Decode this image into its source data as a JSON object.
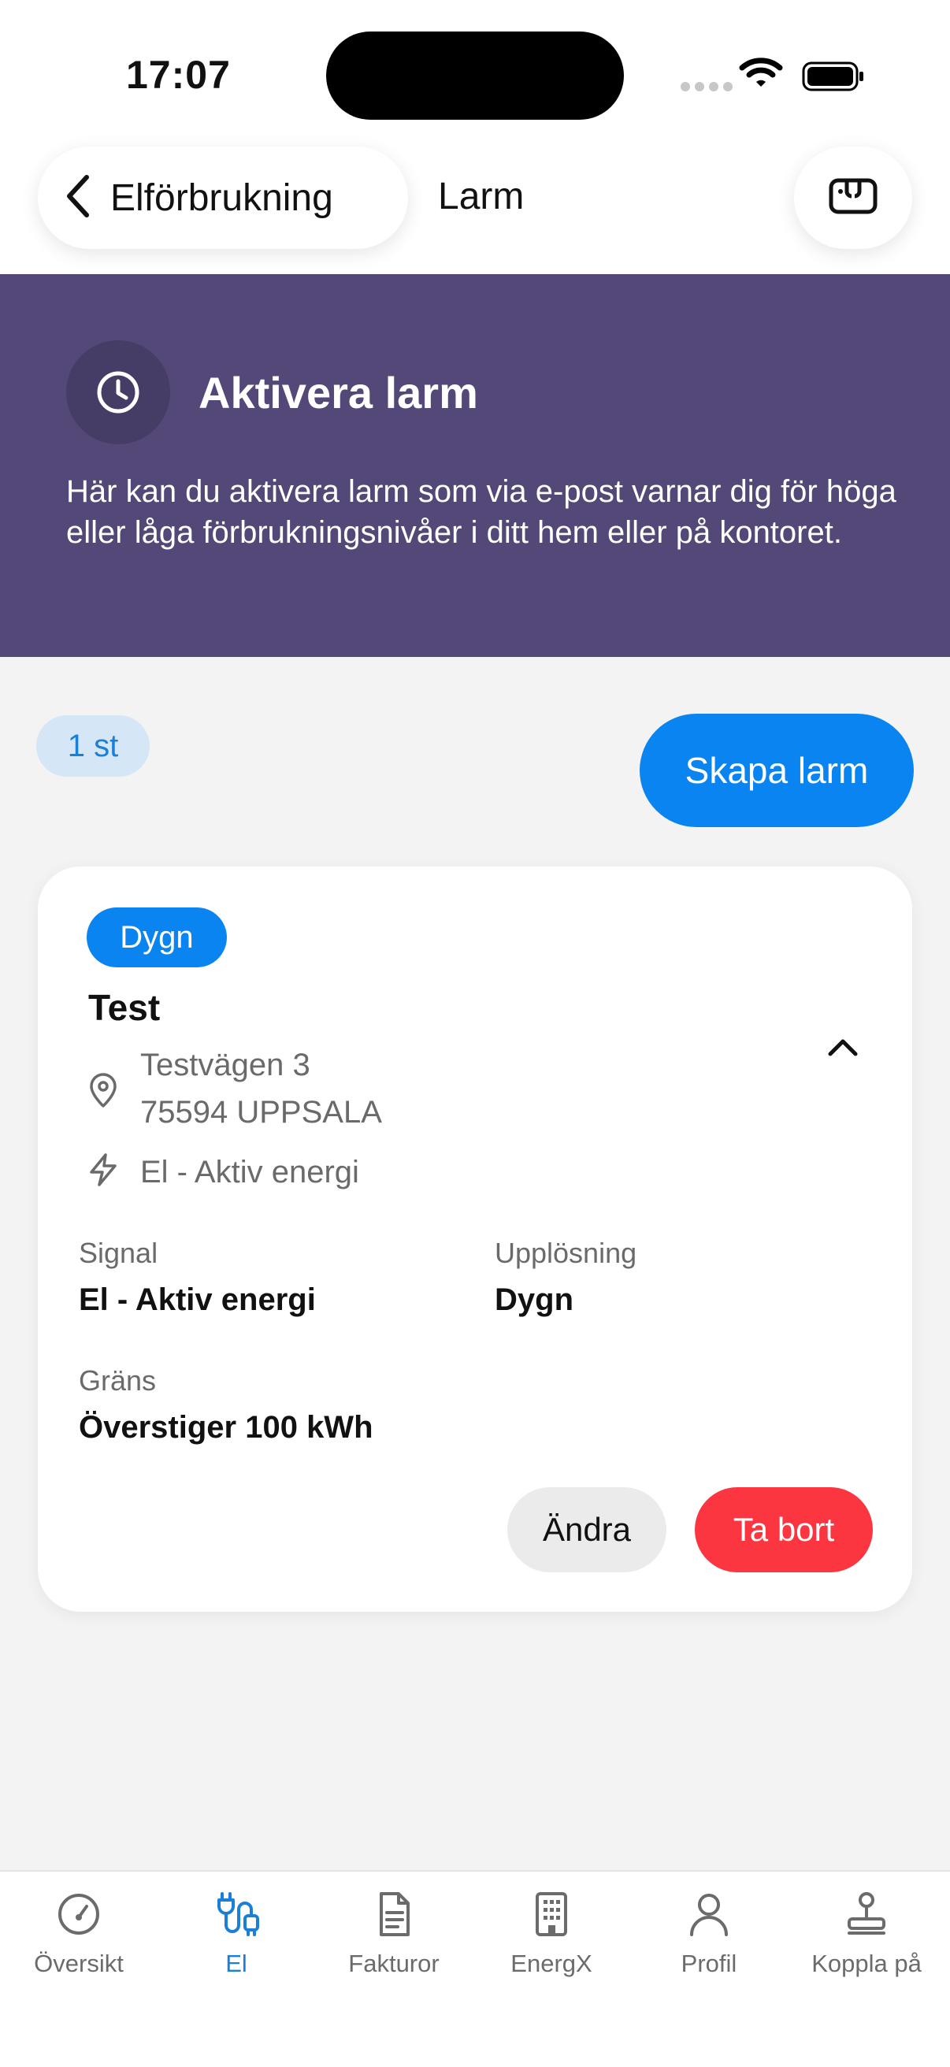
{
  "status_bar": {
    "time": "17:07"
  },
  "nav": {
    "back_label": "Elförbrukning",
    "title": "Larm"
  },
  "banner": {
    "title": "Aktivera larm",
    "text": "Här kan du aktivera larm som via e-post varnar dig för höga eller låga förbrukningsnivåer i ditt hem eller på kontoret."
  },
  "alarms": {
    "count_label": "1 st",
    "create_label": "Skapa larm"
  },
  "alarm_card": {
    "resolution_badge": "Dygn",
    "name": "Test",
    "address_line1": "Testvägen 3",
    "address_line2": "75594 UPPSALA",
    "signal_line": "El - Aktiv energi",
    "signal_label": "Signal",
    "signal_value": "El - Aktiv energi",
    "resolution_label": "Upplösning",
    "resolution_value": "Dygn",
    "limit_label": "Gräns",
    "limit_value": "Överstiger 100 kWh",
    "edit_label": "Ändra",
    "delete_label": "Ta bort"
  },
  "tabbar": {
    "items": [
      {
        "label": "Översikt",
        "icon": "gauge-icon"
      },
      {
        "label": "El",
        "icon": "plug-icon",
        "active": true
      },
      {
        "label": "Fakturor",
        "icon": "document-icon"
      },
      {
        "label": "EnergX",
        "icon": "building-icon"
      },
      {
        "label": "Profil",
        "icon": "person-icon"
      },
      {
        "label": "Koppla på",
        "icon": "connect-icon"
      }
    ]
  },
  "colors": {
    "accent": "#0a84f0",
    "banner": "#534877",
    "danger": "#fb3640",
    "count_badge_bg": "#d5e6f7"
  }
}
